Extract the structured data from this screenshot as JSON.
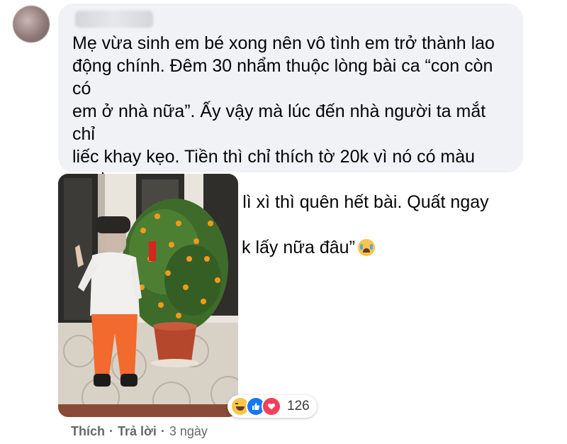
{
  "comment": {
    "text": "Mẹ vừa sinh em bé xong nên vô tình em trở thành lao\nđộng chính. Đêm 30 nhẩm thuộc lòng bài ca “con còn có\nem ở nhà nữa”. Ấy vậy mà lúc đến nhà người ta mắt chỉ\nliếc khay kẹo. Tiền thì chỉ thích tờ 20k vì nó có màu xanh\ncủa siêu nhân. Được lì xì thì quên hết bài. Quất ngay câu\n“con có nhiều rồi con k lấy nữa đâu”",
    "end_emoji": "crying-face-icon"
  },
  "reactions": {
    "icons": [
      "haha-icon",
      "like-icon",
      "love-icon"
    ],
    "count": "126",
    "colors": {
      "haha": "#f7c64b",
      "like": "#1877f2",
      "love": "#f33e58"
    }
  },
  "actions": {
    "like_label": "Thích",
    "separator": "·",
    "reply_label": "Trả lời",
    "separator2": "·",
    "time": "3 ngày"
  }
}
